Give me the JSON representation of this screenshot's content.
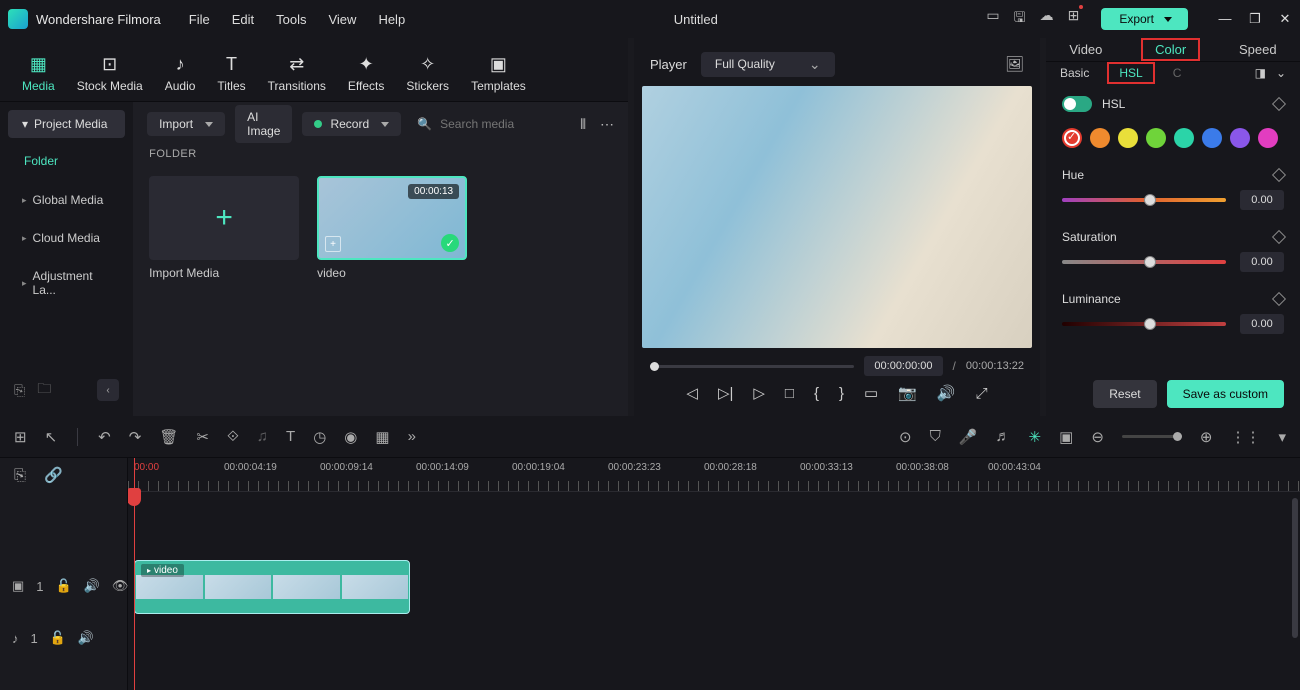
{
  "app": {
    "name": "Wondershare Filmora",
    "doc_title": "Untitled"
  },
  "menu": [
    "File",
    "Edit",
    "Tools",
    "View",
    "Help"
  ],
  "export_label": "Export",
  "tool_tabs": [
    {
      "label": "Media",
      "icon": "▦"
    },
    {
      "label": "Stock Media",
      "icon": "⊡"
    },
    {
      "label": "Audio",
      "icon": "♪"
    },
    {
      "label": "Titles",
      "icon": "T"
    },
    {
      "label": "Transitions",
      "icon": "⇄"
    },
    {
      "label": "Effects",
      "icon": "✦"
    },
    {
      "label": "Stickers",
      "icon": "✧"
    },
    {
      "label": "Templates",
      "icon": "▣"
    }
  ],
  "side": {
    "project_media": "Project Media",
    "folder": "Folder",
    "items": [
      "Global Media",
      "Cloud Media",
      "Adjustment La..."
    ]
  },
  "media_toolbar": {
    "import": "Import",
    "ai_image": "AI Image",
    "record": "Record",
    "search_placeholder": "Search media"
  },
  "folder_label": "FOLDER",
  "thumbs": {
    "import_media": "Import Media",
    "video_name": "video",
    "video_duration": "00:00:13"
  },
  "preview": {
    "player": "Player",
    "quality": "Full Quality",
    "current": "00:00:00:00",
    "total": "00:00:13:22"
  },
  "right_panel": {
    "tabs": [
      "Video",
      "Color",
      "Speed"
    ],
    "subtabs": {
      "basic": "Basic",
      "hsl": "HSL",
      "c": "C"
    },
    "hsl_label": "HSL",
    "swatches": [
      "#e33b2e",
      "#ef8a2e",
      "#e9df3a",
      "#6fd43a",
      "#2bd4a8",
      "#3b7be9",
      "#8a57e9",
      "#e23dc0"
    ],
    "params": [
      {
        "name": "Hue",
        "value": "0.00"
      },
      {
        "name": "Saturation",
        "value": "0.00"
      },
      {
        "name": "Luminance",
        "value": "0.00"
      }
    ],
    "reset": "Reset",
    "save": "Save as custom"
  },
  "timeline": {
    "ticks": [
      "00:00",
      "00:00:04:19",
      "00:00:09:14",
      "00:00:14:09",
      "00:00:19:04",
      "00:00:23:23",
      "00:00:28:18",
      "00:00:33:13",
      "00:00:38:08",
      "00:00:43:04"
    ],
    "clip_label": "video",
    "video_track": "1",
    "audio_track": "1"
  }
}
